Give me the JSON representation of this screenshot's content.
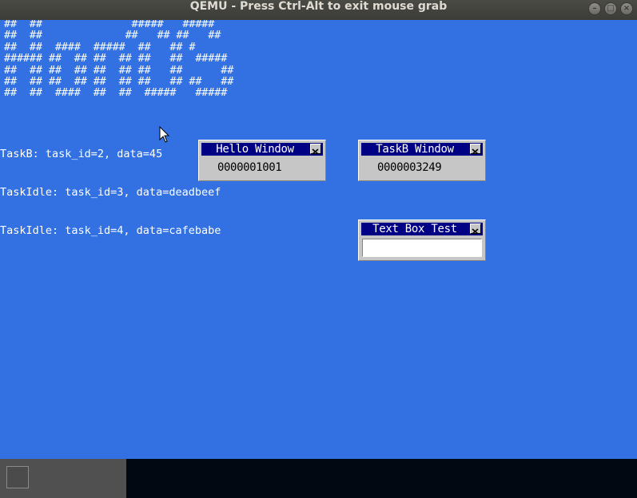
{
  "window": {
    "title": "QEMU - Press Ctrl-Alt to exit mouse grab",
    "minimize_label": "–",
    "maximize_label": "□",
    "close_label": "×"
  },
  "guest": {
    "banner": "##  ##              #####   #####\n##  ##             ##   ## ##   ##\n##  ##  ####  #####  ##   ## #\n###### ##  ## ##  ## ##   ##  #####\n##  ## ##  ## ##  ## ##   ##      ##\n##  ## ##  ## ##  ## ##   ## ##   ##\n##  ##  ####  ##  ##  #####   #####",
    "console_lines": [
      "TaskB: task_id=2, data=45",
      "TaskIdle: task_id=3, data=deadbeef",
      "TaskIdle: task_id=4, data=cafebabe"
    ],
    "windows": [
      {
        "title": "Hello Window",
        "content": "0000001001"
      },
      {
        "title": "TaskB Window",
        "content": "0000003249"
      },
      {
        "title": "Text Box Test",
        "content": ""
      }
    ]
  },
  "colors": {
    "desktop": "#3371e3",
    "window_title_bg": "#000084",
    "window_face": "#c6c6c6",
    "taskbar": "#020812"
  }
}
